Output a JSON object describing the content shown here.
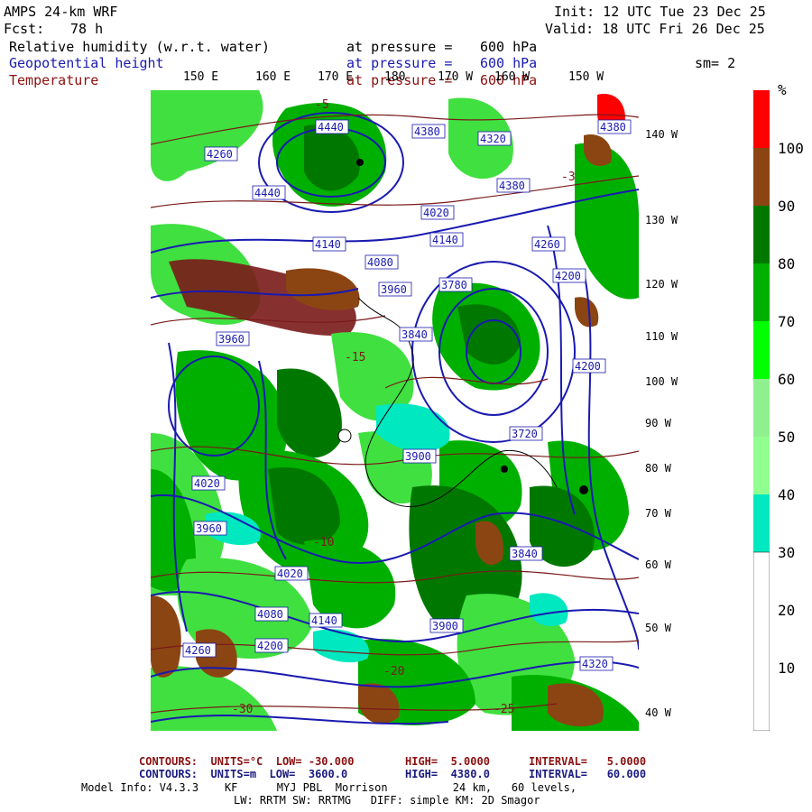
{
  "header": {
    "model": "AMPS 24-km WRF",
    "fcst_label": "Fcst:",
    "fcst_value": "78 h",
    "init": "Init: 12 UTC Tue 23 Dec 25",
    "valid": "Valid: 18 UTC Fri 26 Dec 25",
    "field1": "Relative humidity (w.r.t. water)",
    "field2": "Geopotential height",
    "field3": "Temperature",
    "pressure_label": "at pressure =",
    "pressure_value": "600 hPa",
    "sm": "sm= 2"
  },
  "colors": {
    "rh_30": "#00e8c0",
    "rh_40": "#90ff80",
    "rh_50": "#90f090",
    "rh_60": "#40e040",
    "rh_70": "#00b000",
    "rh_80": "#007800",
    "rh_90": "#8b4513",
    "rh_100": "#ff0000",
    "height_contour": "#1a1ab0",
    "temp_contour": "#7a1a1a"
  },
  "legend": {
    "unit": "%",
    "levels": [
      "100",
      "90",
      "80",
      "70",
      "60",
      "50",
      "40",
      "30",
      "20",
      "10"
    ]
  },
  "longitude_labels": [
    "150 E",
    "160 E",
    "170 E",
    "180",
    "170 W",
    "160 W",
    "150 W"
  ],
  "latitude_labels": [
    "140 W",
    "130 W",
    "120 W",
    "110 W",
    "100 W",
    "90 W",
    "80 W",
    "70 W",
    "60 W",
    "50 W",
    "40 W"
  ],
  "height_labels": [
    "4440",
    "4260",
    "4380",
    "4320",
    "4440",
    "4140",
    "4020",
    "4140",
    "4260",
    "4380",
    "3960",
    "4080",
    "3780",
    "4200",
    "3960",
    "3840",
    "4020",
    "3900",
    "3720",
    "4200",
    "3960",
    "4020",
    "3840",
    "3900",
    "4080",
    "4140",
    "4200",
    "4260",
    "4320",
    "4380"
  ],
  "temp_labels": [
    "-5",
    "-3",
    "-15",
    "-10",
    "-20",
    "-25",
    "-30"
  ],
  "footer": {
    "line1_a": "CONTOURS:  UNITS=°C  LOW= -30.000",
    "line1_b": "HIGH=  5.0000",
    "line1_c": "INTERVAL=   5.0000",
    "line2_a": "CONTOURS:  UNITS=m  LOW=  3600.0",
    "line2_b": "HIGH=  4380.0",
    "line2_c": "INTERVAL=   60.000",
    "line3": "Model Info: V4.3.3    KF      MYJ PBL  Morrison          24 km,   60 levels,",
    "line4": "LW: RRTM SW: RRTMG   DIFF: simple KM: 2D Smagor"
  }
}
